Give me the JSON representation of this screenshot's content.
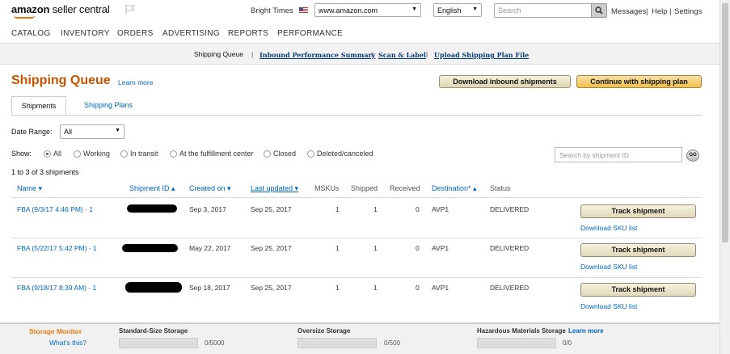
{
  "header": {
    "logo_bold": "amazon",
    "logo_rest": " seller central",
    "bright_times": "Bright Times",
    "marketplace": "www.amazon.com",
    "language": "English",
    "search_placeholder": "Search",
    "links": [
      "Messages",
      "Help",
      "Settings"
    ]
  },
  "nav": [
    "CATALOG",
    "INVENTORY",
    "ORDERS",
    "ADVERTISING",
    "REPORTS",
    "PERFORMANCE"
  ],
  "subnav": {
    "active": "Shipping Queue",
    "links": [
      "Inbound Performance Summary",
      "Scan & Label",
      "Upload Shipping Plan File"
    ]
  },
  "page": {
    "title": "Shipping Queue",
    "learn_more": "Learn more",
    "btn_download": "Download inbound shipments",
    "btn_continue": "Continue with shipping plan",
    "tabs": [
      "Shipments",
      "Shipping Plans"
    ],
    "date_range_label": "Date Range:",
    "date_range_value": "All",
    "show_label": "Show:",
    "show_options": [
      "All",
      "Working",
      "In transit",
      "At the fulfillment center",
      "Closed",
      "Deleted/canceled"
    ],
    "shipment_search_placeholder": "Search by shipment ID",
    "go": "GO",
    "count_text": "1 to 3 of 3 shipments"
  },
  "table": {
    "headers": [
      "Name",
      "Shipment ID",
      "Created on",
      "Last updated",
      "MSKUs",
      "Shipped",
      "Received",
      "Destination*",
      "Status"
    ],
    "rows": [
      {
        "name": "FBA (9/3/17 4:46 PM) - 1",
        "created": "Sep 3, 2017",
        "updated": "Sep 25, 2017",
        "mskus": "1",
        "shipped": "1",
        "received": "0",
        "destination": "AVP1",
        "status": "DELIVERED",
        "track": "Track shipment",
        "download": "Download SKU list"
      },
      {
        "name": "FBA (5/22/17 5:42 PM) - 1",
        "created": "May 22, 2017",
        "updated": "Sep 25, 2017",
        "mskus": "1",
        "shipped": "1",
        "received": "0",
        "destination": "AVP1",
        "status": "DELIVERED",
        "track": "Track shipment",
        "download": "Download SKU list"
      },
      {
        "name": "FBA (9/18/17 8:39 AM) - 1",
        "created": "Sep 18, 2017",
        "updated": "Sep 25, 2017",
        "mskus": "1",
        "shipped": "1",
        "received": "0",
        "destination": "AVP1",
        "status": "DELIVERED",
        "track": "Track shipment",
        "download": "Download SKU list"
      }
    ]
  },
  "footer": {
    "storage_monitor": "Storage Monitor",
    "whats_this": "What's this?",
    "standard_label": "Standard-Size Storage",
    "standard_value": "0/5000",
    "oversize_label": "Oversize Storage",
    "oversize_value": "0/500",
    "hazmat_label": "Hazardous Materials Storage",
    "hazmat_learn": "Learn more",
    "hazmat_value": "0/0"
  },
  "colors": {
    "title": "#c45500",
    "link": "#0066c0",
    "storage_monitor": "#e47911"
  }
}
